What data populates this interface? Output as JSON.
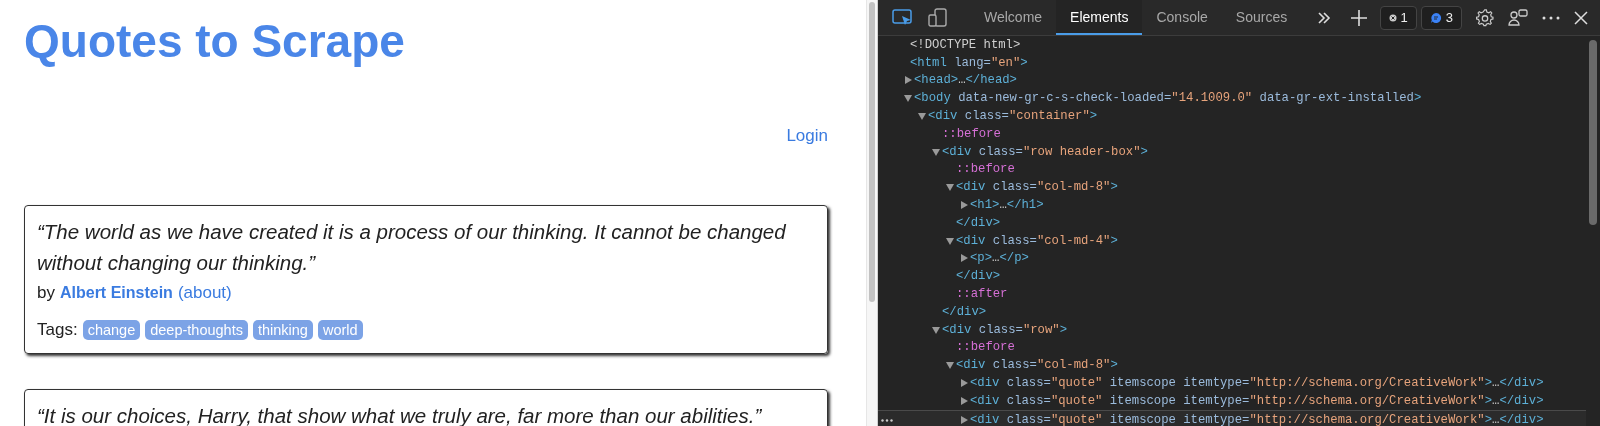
{
  "page": {
    "title": "Quotes to Scrape",
    "login": "Login",
    "quotes": [
      {
        "text": "“The world as we have created it is a process of our thinking. It cannot be changed without changing our thinking.”",
        "by": "by",
        "author": "Albert Einstein",
        "about": "(about)",
        "tags_label": "Tags:",
        "tags": [
          "change",
          "deep-thoughts",
          "thinking",
          "world"
        ]
      },
      {
        "text": "“It is our choices, Harry, that show what we truly are, far more than our abilities.”"
      }
    ]
  },
  "devtools": {
    "tabs": [
      {
        "label": "Welcome",
        "selected": false
      },
      {
        "label": "Elements",
        "selected": true
      },
      {
        "label": "Console",
        "selected": false
      },
      {
        "label": "Sources",
        "selected": false
      }
    ],
    "badges": [
      {
        "kind": "errors",
        "count": "1"
      },
      {
        "kind": "messages",
        "count": "3"
      }
    ],
    "dom": [
      {
        "kind": "doctype",
        "text": "<!DOCTYPE html>",
        "selected": false
      },
      {
        "kind": "element",
        "text": "<html lang=\"en\">",
        "selected": false,
        "children": [
          {
            "kind": "element",
            "text": "<head>…</head>",
            "expanded": false,
            "selected": false
          },
          {
            "kind": "element",
            "text": "<body data-new-gr-c-s-check-loaded=\"14.1009.0\" data-gr-ext-installed>",
            "expanded": true,
            "selected": false,
            "children": [
              {
                "kind": "element",
                "text": "<div class=\"container\">",
                "expanded": true,
                "selected": false,
                "children": [
                  {
                    "kind": "pseudo",
                    "text": "::before",
                    "selected": false
                  },
                  {
                    "kind": "element",
                    "text": "<div class=\"row header-box\">",
                    "expanded": true,
                    "selected": false,
                    "close": "</div>",
                    "children": [
                      {
                        "kind": "pseudo",
                        "text": "::before",
                        "selected": false
                      },
                      {
                        "kind": "element",
                        "text": "<div class=\"col-md-8\">",
                        "expanded": true,
                        "selected": false,
                        "close": "</div>",
                        "children": [
                          {
                            "kind": "element",
                            "text": "<h1>…</h1>",
                            "expanded": false,
                            "selected": false
                          }
                        ]
                      },
                      {
                        "kind": "element",
                        "text": "<div class=\"col-md-4\">",
                        "expanded": true,
                        "selected": false,
                        "close": "</div>",
                        "children": [
                          {
                            "kind": "element",
                            "text": "<p>…</p>",
                            "expanded": false,
                            "selected": false
                          }
                        ]
                      },
                      {
                        "kind": "pseudo",
                        "text": "::after",
                        "selected": false
                      }
                    ]
                  },
                  {
                    "kind": "element",
                    "text": "<div class=\"row\">",
                    "expanded": true,
                    "selected": false,
                    "children": [
                      {
                        "kind": "pseudo",
                        "text": "::before",
                        "selected": false
                      },
                      {
                        "kind": "element",
                        "text": "<div class=\"col-md-8\">",
                        "expanded": true,
                        "selected": false,
                        "children": [
                          {
                            "kind": "element",
                            "text": "<div class=\"quote\" itemscope itemtype=\"http://schema.org/CreativeWork\">…</div>",
                            "expanded": false,
                            "selected": false
                          },
                          {
                            "kind": "element",
                            "text": "<div class=\"quote\" itemscope itemtype=\"http://schema.org/CreativeWork\">…</div>",
                            "expanded": false,
                            "selected": false
                          },
                          {
                            "kind": "element",
                            "text": "<div class=\"quote\" itemscope itemtype=\"http://schema.org/CreativeWork\">…</div>",
                            "expanded": false,
                            "selected": true
                          }
                        ]
                      }
                    ]
                  }
                ]
              }
            ]
          }
        ]
      }
    ]
  }
}
